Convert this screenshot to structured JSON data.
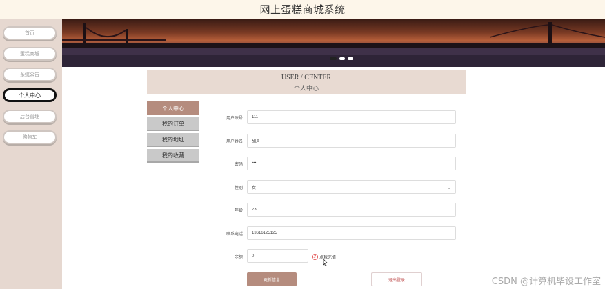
{
  "app": {
    "title": "网上蛋糕商城系统"
  },
  "nav": {
    "items": [
      {
        "label": "首页"
      },
      {
        "label": "蛋糕商城"
      },
      {
        "label": "系统公告"
      },
      {
        "label": "个人中心",
        "active": true
      },
      {
        "label": "后台管理"
      },
      {
        "label": "购物车"
      }
    ]
  },
  "banner": {
    "slide_count": 3,
    "active_slide": 0
  },
  "center": {
    "title_en": "USER / CENTER",
    "title_cn": "个人中心"
  },
  "submenu": {
    "items": [
      {
        "label": "个人中心",
        "active": true
      },
      {
        "label": "我的订单"
      },
      {
        "label": "我的地址"
      },
      {
        "label": "我的收藏"
      }
    ]
  },
  "form": {
    "account": {
      "label": "用户账号",
      "value": "111"
    },
    "name": {
      "label": "用户姓名",
      "value": "胡月"
    },
    "password": {
      "label": "密码",
      "value": "•••"
    },
    "gender": {
      "label": "性别",
      "value": "女"
    },
    "age": {
      "label": "年龄",
      "value": "23"
    },
    "phone": {
      "label": "联系电话",
      "value": "13616125125"
    },
    "balance": {
      "label": "余额",
      "value": "0",
      "recharge_label": "点我充值"
    }
  },
  "actions": {
    "update_label": "更新信息",
    "logout_label": "退出登录"
  },
  "watermark": "CSDN @计算机毕设工作室",
  "colors": {
    "accent": "#b58c7e",
    "sidebar": "#e6d8d0",
    "header_bg": "#fdf6ea"
  }
}
